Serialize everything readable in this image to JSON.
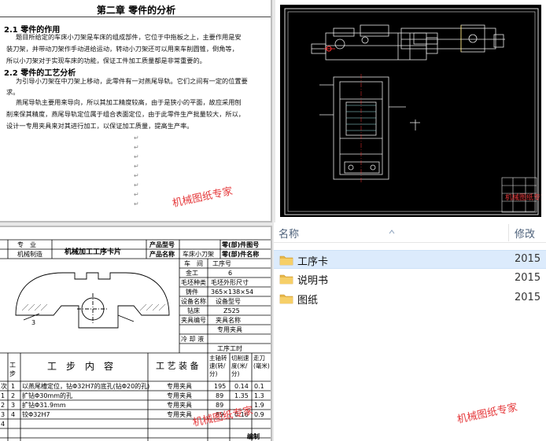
{
  "document": {
    "chapter_title": "第二章  零件的分析",
    "section1_heading": "2.1 零件的作用",
    "section1_lines": [
      "题目所给定的车床小刀架是车床的组成部件，它位于中拖板之上，主要作用是安",
      "装刀架，并带动刀架作手动进给运动，转动小刀架还可以用来车削圆锥，倒角等，",
      "所以小刀架对于实现车床的功能，保证工件加工质量都是非常重要的。"
    ],
    "section2_heading": "2.2 零件的工艺分析",
    "section2_lines": [
      "为引导小刀架在中刀架上移动，此零件有一对燕尾导轨。它们之间有一定的位置要",
      "求。"
    ],
    "section3_lines": [
      "燕尾导轨主要用来导向，所以其加工精度较高，由于是狭小的平面，故应采用刨",
      "削来保其精度，燕尾导轨定位属于组合表面定位，由于此零件生产批量较大，所以，",
      "设计一专用夹具来对其进行加工，以保证加工质量，提高生产率。"
    ],
    "watermark": "机械图纸专家"
  },
  "cad": {
    "stamp_text": "机械图纸专家"
  },
  "card": {
    "hdr_major": "专　业",
    "hdr_major_val": "机械制造",
    "hdr_title": "机械加工工序卡片",
    "hdr_model_label": "产品型号",
    "hdr_name_label": "产品名称",
    "hdr_name_val": "车床小刀架",
    "hdr_partno_label": "零(部)件图号",
    "hdr_partname_label": "零(部)件名称",
    "right_fields": [
      {
        "label": "车　间",
        "value": "工序号"
      },
      {
        "label": "金工",
        "value": "6"
      },
      {
        "label": "毛坯种类",
        "value": "毛坯外形尺寸"
      },
      {
        "label": "铸件",
        "value": "365×138×54"
      },
      {
        "label": "设备名称",
        "value": "设备型号"
      },
      {
        "label": "钻床",
        "value": "Z525"
      },
      {
        "label": "夹具编号",
        "value": "夹具名称"
      },
      {
        "label": "",
        "value": "专用夹具"
      },
      {
        "label": "冷 却 液",
        "value": ""
      },
      {
        "label": "",
        "value": "工序工时"
      }
    ],
    "col_step": "工步",
    "col_content": "工　步　内　容",
    "col_equipment": "工 艺 装 备",
    "col_speed": "主轴转速(转/分)",
    "col_cut_speed": "切削速度(米/分)",
    "col_feed": "走刀(毫米)",
    "rows": [
      {
        "no": "1",
        "content": "以燕尾槽定位，钻Φ32H7的底孔(钻Φ20的孔)",
        "equip": "专用夹具",
        "speed": "195",
        "cut": "0.14",
        "feed": "0.1"
      },
      {
        "no": "2",
        "content": "扩钻Φ30mm的孔",
        "equip": "专用夹具",
        "speed": "89",
        "cut": "1.35",
        "feed": "1.3"
      },
      {
        "no": "3",
        "content": "扩钻Φ31.9mm",
        "equip": "专用夹具",
        "speed": "89",
        "cut": "",
        "feed": "1.9"
      },
      {
        "no": "4",
        "content": "铰Φ32H7",
        "equip": "专用夹具",
        "speed": "89",
        "cut": "0.16",
        "feed": "0.9"
      }
    ],
    "row_left_marks": [
      "次",
      "1",
      "2",
      "3",
      "4"
    ],
    "footer_label": "编制",
    "watermark": "机械图纸专家",
    "dim_label": "3"
  },
  "explorer": {
    "col_name": "名称",
    "col_modified": "修改",
    "items": [
      {
        "name": "工序卡",
        "date": "2015",
        "selected": true
      },
      {
        "name": "说明书",
        "date": "2015",
        "selected": false
      },
      {
        "name": "图纸",
        "date": "2015",
        "selected": false
      }
    ],
    "watermark": "机械图纸专家",
    "colors": {
      "folder": "#e8b84a",
      "selected": "#dcebfc",
      "header_text": "#4c607a"
    }
  }
}
